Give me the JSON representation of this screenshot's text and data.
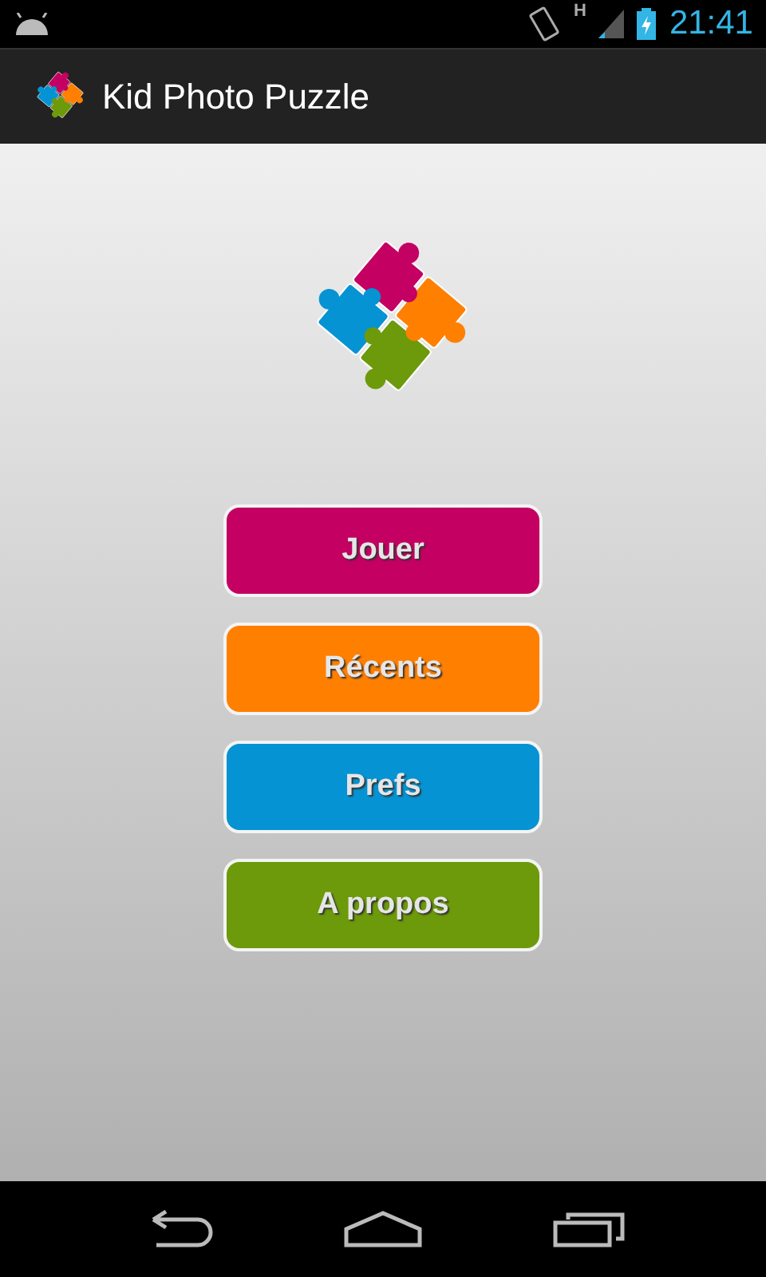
{
  "status_bar": {
    "time": "21:41",
    "network": "H"
  },
  "action_bar": {
    "title": "Kid Photo Puzzle"
  },
  "buttons": [
    {
      "label": "Jouer",
      "color": "#c40062"
    },
    {
      "label": "Récents",
      "color": "#ff7f00"
    },
    {
      "label": "Prefs",
      "color": "#0593d3"
    },
    {
      "label": "A propos",
      "color": "#6c9a0a"
    }
  ]
}
